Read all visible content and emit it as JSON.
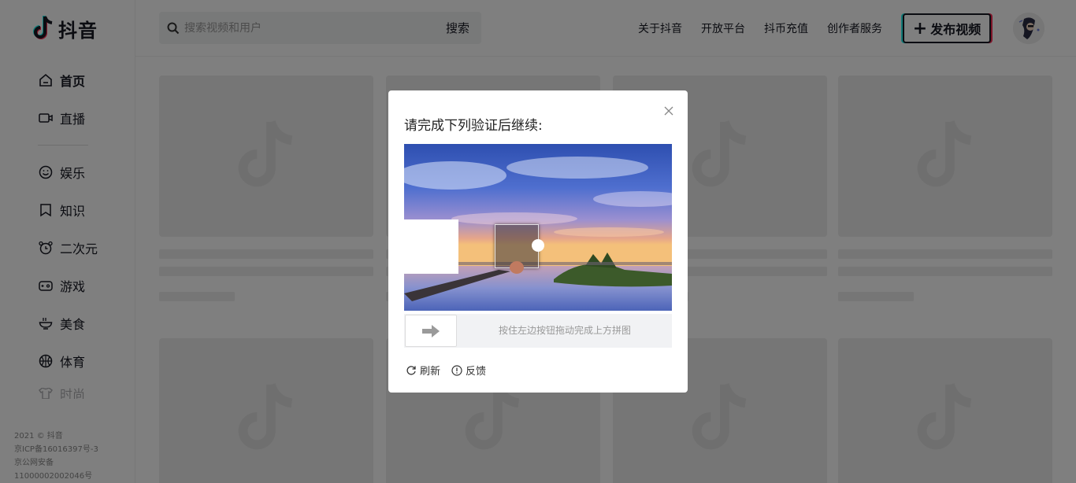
{
  "brand": {
    "name": "抖音"
  },
  "sidebar": {
    "items": [
      {
        "label": "首页",
        "icon": "home-icon"
      },
      {
        "label": "直播",
        "icon": "live-icon"
      },
      {
        "label": "娱乐",
        "icon": "smile-icon"
      },
      {
        "label": "知识",
        "icon": "bookmark-icon"
      },
      {
        "label": "二次元",
        "icon": "clock-icon"
      },
      {
        "label": "游戏",
        "icon": "gamepad-icon"
      },
      {
        "label": "美食",
        "icon": "bowl-icon"
      },
      {
        "label": "体育",
        "icon": "ball-icon"
      },
      {
        "label": "时尚",
        "icon": "fashion-icon"
      }
    ],
    "footer": {
      "line1": "2021 © 抖音",
      "line2": "京ICP备16016397号-3",
      "line3": "京公网安备",
      "line4": "11000002002046号"
    }
  },
  "header": {
    "search_placeholder": "搜索视频和用户",
    "search_button": "搜索",
    "links": [
      "关于抖音",
      "开放平台",
      "抖币充值",
      "创作者服务"
    ],
    "publish_plus": "+",
    "publish_label": "发布视频"
  },
  "modal": {
    "title": "请完成下列验证后继续:",
    "slider_hint": "按住左边按钮拖动完成上方拼图",
    "refresh_label": "刷新",
    "feedback_label": "反馈"
  },
  "colors": {
    "accent_cyan": "#25f4ee",
    "accent_red": "#fe2c55",
    "text": "#161823"
  }
}
